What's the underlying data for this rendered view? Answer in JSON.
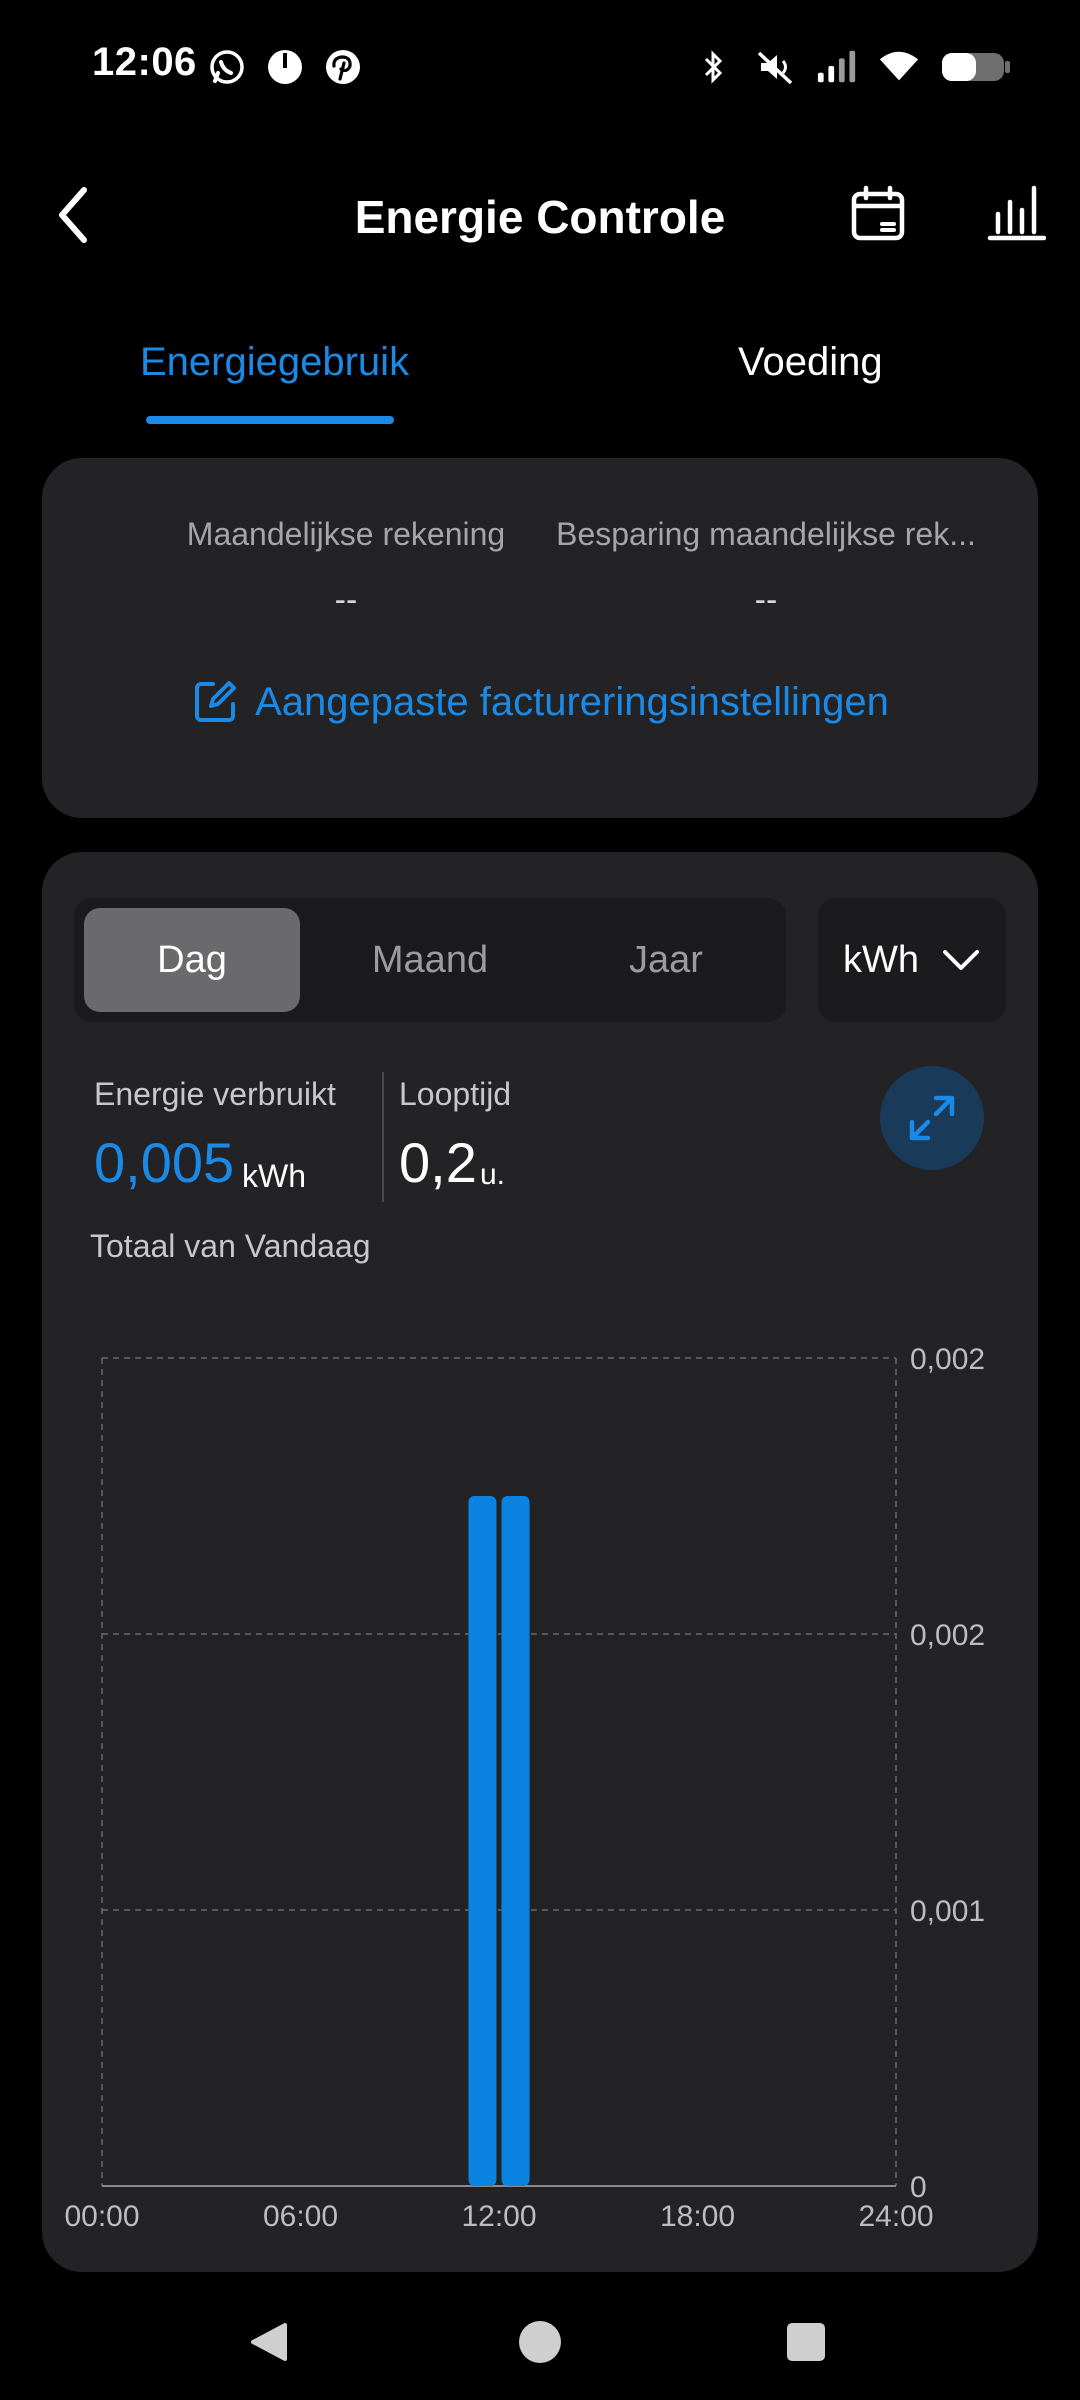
{
  "status_bar": {
    "time": "12:06",
    "left_icons": [
      "whatsapp-icon",
      "timer-icon",
      "pinterest-icon"
    ],
    "right_icons": [
      "bluetooth-icon",
      "mute-icon",
      "signal-icon",
      "wifi-icon",
      "battery-icon"
    ]
  },
  "header": {
    "title": "Energie Controle"
  },
  "tabs": [
    {
      "label": "Energiegebruik",
      "active": true
    },
    {
      "label": "Voeding",
      "active": false
    }
  ],
  "billing": {
    "monthly_bill_label": "Maandelijkse rekening",
    "monthly_bill_value": "--",
    "monthly_savings_label": "Besparing maandelijkse rek...",
    "monthly_savings_value": "--",
    "settings_link": "Aangepaste factureringsinstellingen"
  },
  "energy": {
    "periods": [
      "Dag",
      "Maand",
      "Jaar"
    ],
    "selected_period": "Dag",
    "unit_select": "kWh",
    "consumed_label": "Energie verbruikt",
    "consumed_value": "0,005",
    "consumed_unit": "kWh",
    "runtime_label": "Looptijd",
    "runtime_value": "0,2",
    "runtime_unit": "u.",
    "total_label": "Totaal van Vandaag"
  },
  "colors": {
    "accent": "#1a8ae6",
    "card_bg": "#232326",
    "bar": "#0a84e0"
  },
  "chart_data": {
    "type": "bar",
    "x_tick_labels": [
      "00:00",
      "06:00",
      "12:00",
      "18:00",
      "24:00"
    ],
    "y_tick_labels": [
      "0,002",
      "0,002",
      "0,001",
      "0"
    ],
    "y_tick_values": [
      0.003,
      0.002,
      0.001,
      0
    ],
    "ylim": [
      0,
      0.003
    ],
    "xlim": [
      0,
      24
    ],
    "bars": [
      {
        "x": 11,
        "value": 0.0025
      },
      {
        "x": 12,
        "value": 0.0025
      }
    ],
    "grid": true,
    "y_axis_position": "right"
  }
}
